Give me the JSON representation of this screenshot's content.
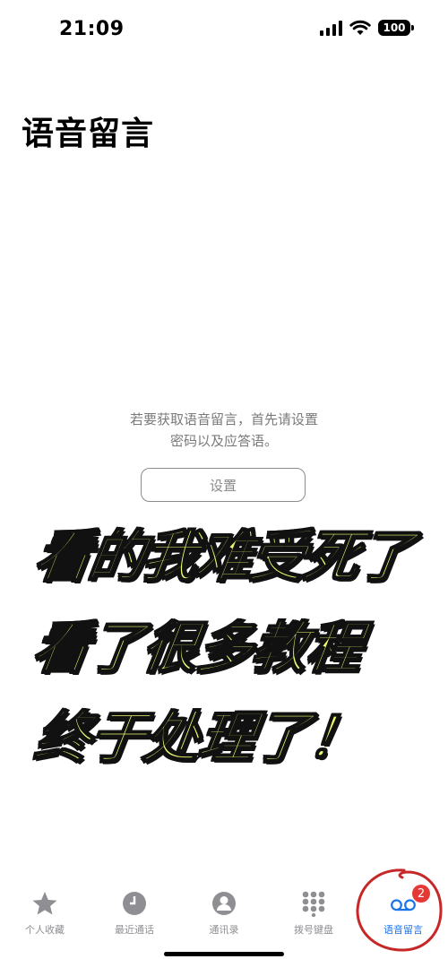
{
  "status_bar": {
    "time": "21:09",
    "battery": "100"
  },
  "page": {
    "title": "语音留言",
    "info_line1": "若要获取语音留言，首先请设置",
    "info_line2": "密码以及应答语。",
    "setup_button": "设置"
  },
  "overlay": {
    "line1": "看的我难受死了",
    "line2": "看了很多教程",
    "line3": "终于处理了！"
  },
  "tabs": [
    {
      "label": "个人收藏",
      "icon": "star-icon"
    },
    {
      "label": "最近通话",
      "icon": "clock-icon"
    },
    {
      "label": "通讯录",
      "icon": "contacts-icon"
    },
    {
      "label": "拨号键盘",
      "icon": "keypad-icon"
    },
    {
      "label": "语音留言",
      "icon": "voicemail-icon",
      "badge": "2",
      "active": true
    }
  ],
  "colors": {
    "accent": "#1a73e8",
    "badge": "#e53935",
    "caption": "#eef96f",
    "annotation": "#c62828"
  }
}
